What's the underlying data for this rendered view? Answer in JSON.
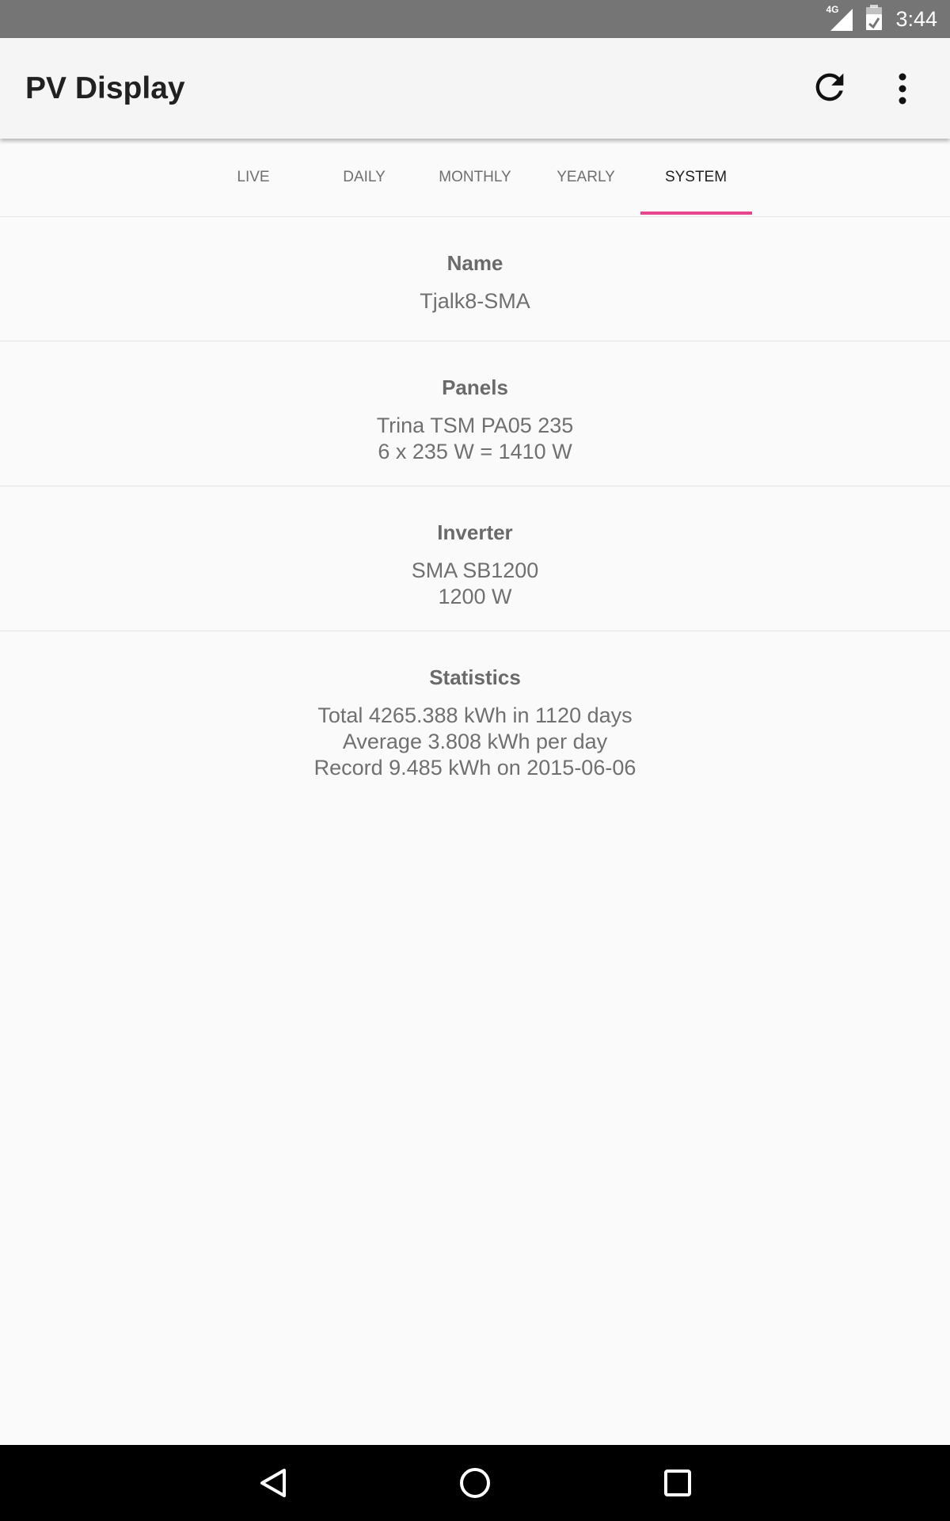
{
  "status_bar": {
    "network_label": "4G",
    "time": "3:44"
  },
  "app_bar": {
    "title": "PV Display",
    "refresh_icon": "refresh-icon",
    "overflow_icon": "more-vert-icon"
  },
  "tabs": {
    "items": [
      {
        "label": "LIVE",
        "selected": false
      },
      {
        "label": "DAILY",
        "selected": false
      },
      {
        "label": "MONTHLY",
        "selected": false
      },
      {
        "label": "YEARLY",
        "selected": false
      },
      {
        "label": "SYSTEM",
        "selected": true
      }
    ],
    "indicator_color": "#e8468a"
  },
  "system": {
    "name": {
      "title": "Name",
      "value": "Tjalk8-SMA"
    },
    "panels": {
      "title": "Panels",
      "model": "Trina TSM PA05 235",
      "capacity": "6 x 235 W = 1410 W"
    },
    "inverter": {
      "title": "Inverter",
      "model": "SMA SB1200",
      "power": "1200 W"
    },
    "statistics": {
      "title": "Statistics",
      "total": "Total 4265.388 kWh in 1120 days",
      "average": "Average 3.808 kWh per day",
      "record": "Record 9.485 kWh on 2015-06-06"
    }
  },
  "nav_bar": {
    "back_icon": "back-icon",
    "home_icon": "home-icon",
    "recents_icon": "recents-icon"
  }
}
